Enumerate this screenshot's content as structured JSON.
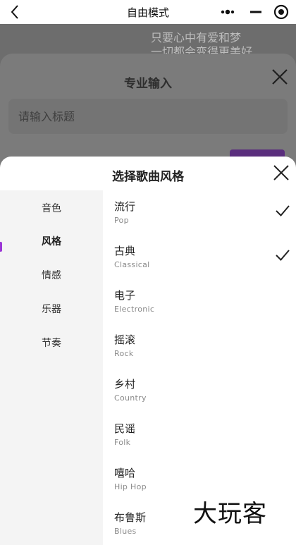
{
  "nav": {
    "title": "自由模式"
  },
  "background": {
    "lyric_line1": "只要心中有爱和梦",
    "lyric_line2": "一切都会变得更美好"
  },
  "pro_input": {
    "title": "专业输入",
    "title_placeholder": "请输入标题"
  },
  "sheet": {
    "title": "选择歌曲风格",
    "sidebar": [
      {
        "label": "音色"
      },
      {
        "label": "风格",
        "active": true
      },
      {
        "label": "情感"
      },
      {
        "label": "乐器"
      },
      {
        "label": "节奏"
      }
    ],
    "options": [
      {
        "cn": "流行",
        "en": "Pop",
        "selected": true
      },
      {
        "cn": "古典",
        "en": "Classical",
        "selected": true
      },
      {
        "cn": "电子",
        "en": "Electronic",
        "selected": false
      },
      {
        "cn": "摇滚",
        "en": "Rock",
        "selected": false
      },
      {
        "cn": "乡村",
        "en": "Country",
        "selected": false
      },
      {
        "cn": "民谣",
        "en": "Folk",
        "selected": false
      },
      {
        "cn": "嘻哈",
        "en": "Hip Hop",
        "selected": false
      },
      {
        "cn": "布鲁斯",
        "en": "Blues",
        "selected": false
      }
    ]
  },
  "watermark": {
    "text": "大玩客"
  },
  "colors": {
    "accent": "#9b35d6",
    "overlay": "#6d6d6d"
  }
}
